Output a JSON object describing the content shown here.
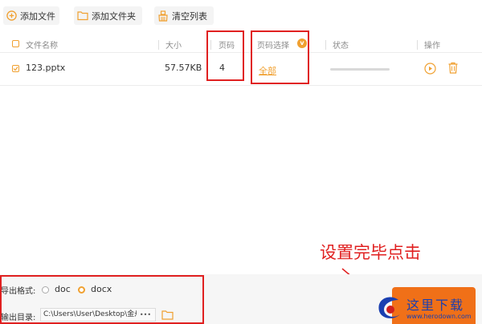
{
  "toolbar": {
    "add_file_label": "添加文件",
    "add_folder_label": "添加文件夹",
    "clear_list_label": "清空列表"
  },
  "table": {
    "headers": [
      "文件名称",
      "大小",
      "页码",
      "页码选择",
      "状态",
      "操作"
    ],
    "header_badge": "v",
    "rows": [
      {
        "name": "123.pptx",
        "size": "57.57KB",
        "pages": "4",
        "page_select": "全部",
        "progress": 0
      }
    ]
  },
  "annotation": {
    "text": "设置完毕点击"
  },
  "bottom": {
    "format_label": "导出格式:",
    "format_options": [
      "doc",
      "docx"
    ],
    "format_selected": "docx",
    "output_label": "输出目录:",
    "output_path": "C:\\Users\\User\\Desktop\\金舟",
    "more_label": "•••"
  },
  "watermark": {
    "text": "这里下载",
    "url_text": "www.herodown.com"
  },
  "colors": {
    "accent": "#f0a030",
    "highlight": "#e02020",
    "watermark": "#1a3fb0"
  }
}
